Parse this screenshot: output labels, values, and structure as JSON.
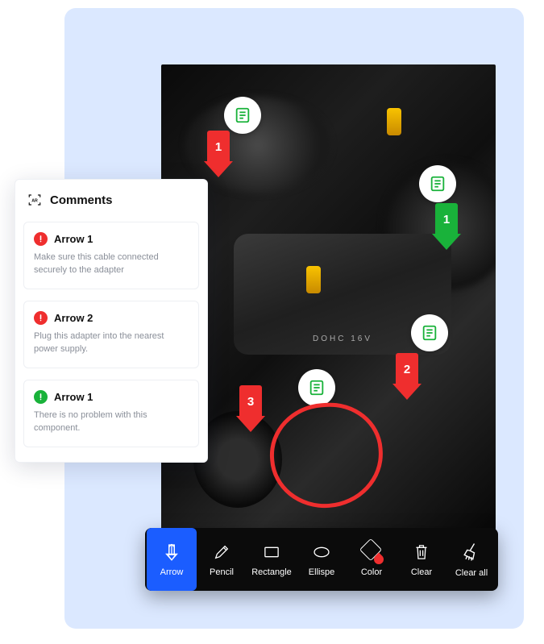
{
  "engine_label": "DOHC 16V",
  "comments": {
    "title": "Comments",
    "items": [
      {
        "status": "red",
        "title": "Arrow 1",
        "body": "Make sure this cable connected securely to the adapter"
      },
      {
        "status": "red",
        "title": "Arrow 2",
        "body": "Plug this adapter into the nearest power supply."
      },
      {
        "status": "green",
        "title": "Arrow 1",
        "body": "There is no problem with this component."
      }
    ]
  },
  "annotations": {
    "arrows": [
      {
        "num": "1",
        "color": "red"
      },
      {
        "num": "1",
        "color": "green"
      },
      {
        "num": "2",
        "color": "red"
      },
      {
        "num": "3",
        "color": "red"
      }
    ]
  },
  "toolbar": {
    "arrow": "Arrow",
    "pencil": "Pencil",
    "rectangle": "Rectangle",
    "ellipse": "Ellispe",
    "color": "Color",
    "clear": "Clear",
    "clear_all": "Clear all"
  }
}
